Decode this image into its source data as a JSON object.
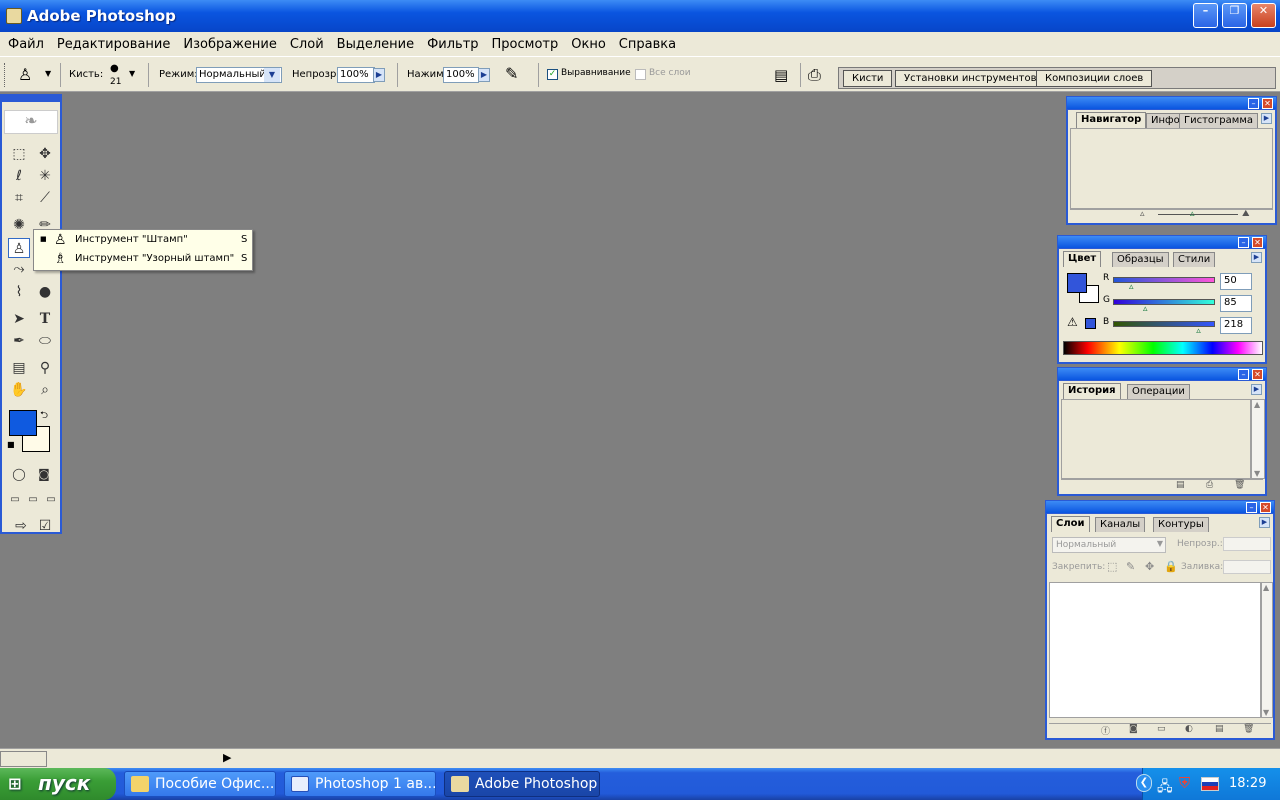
{
  "window": {
    "title": "Adobe Photoshop"
  },
  "menu": [
    "Файл",
    "Редактирование",
    "Изображение",
    "Слой",
    "Выделение",
    "Фильтр",
    "Просмотр",
    "Окно",
    "Справка"
  ],
  "options": {
    "brush_label": "Кисть:",
    "brush_size": "21",
    "mode_label": "Режим:",
    "mode_value": "Нормальный",
    "opacity_label": "Непрозр.:",
    "opacity_value": "100%",
    "pressure_label": "Нажим:",
    "pressure_value": "100%",
    "aligned_label": "Выравнивание",
    "aligned_checked": true,
    "all_layers_label": "Все слои",
    "all_layers_checked": false
  },
  "palette_well": [
    "Кисти",
    "Установки инструментов",
    "Композиции слоев"
  ],
  "flyout": [
    {
      "label": "Инструмент \"Штамп\"",
      "key": "S",
      "selected": true
    },
    {
      "label": "Инструмент \"Узорный штамп\"",
      "key": "S",
      "selected": false
    }
  ],
  "toolbox": {
    "foreground_color": "#0f5ae0",
    "background_color": "#fffbe8"
  },
  "navigator": {
    "tabs": [
      "Навигатор",
      "Инфо",
      "Гистограмма"
    ],
    "active": 0
  },
  "color": {
    "tabs": [
      "Цвет",
      "Образцы",
      "Стили"
    ],
    "active": 0,
    "channels": [
      {
        "name": "R",
        "value": "50",
        "fraction": 0.196
      },
      {
        "name": "G",
        "value": "85",
        "fraction": 0.333
      },
      {
        "name": "B",
        "value": "218",
        "fraction": 0.855
      }
    ],
    "swatch": "#3255da"
  },
  "history": {
    "tabs": [
      "История",
      "Операции"
    ],
    "active": 0
  },
  "layers": {
    "tabs": [
      "Слои",
      "Каналы",
      "Контуры"
    ],
    "active": 0,
    "blend_mode": "Нормальный",
    "opacity_label": "Непрозр.:",
    "lock_label": "Закрепить:",
    "fill_label": "Заливка:"
  },
  "taskbar": {
    "start_label": "пуск",
    "tasks": [
      {
        "label": "Пособие Офис...",
        "icon": "folder-icon",
        "active": false
      },
      {
        "label": "Photoshop 1 ав...",
        "icon": "word-icon",
        "active": false
      },
      {
        "label": "Adobe Photoshop",
        "icon": "photoshop-icon",
        "active": true
      }
    ],
    "clock": "18:29"
  }
}
